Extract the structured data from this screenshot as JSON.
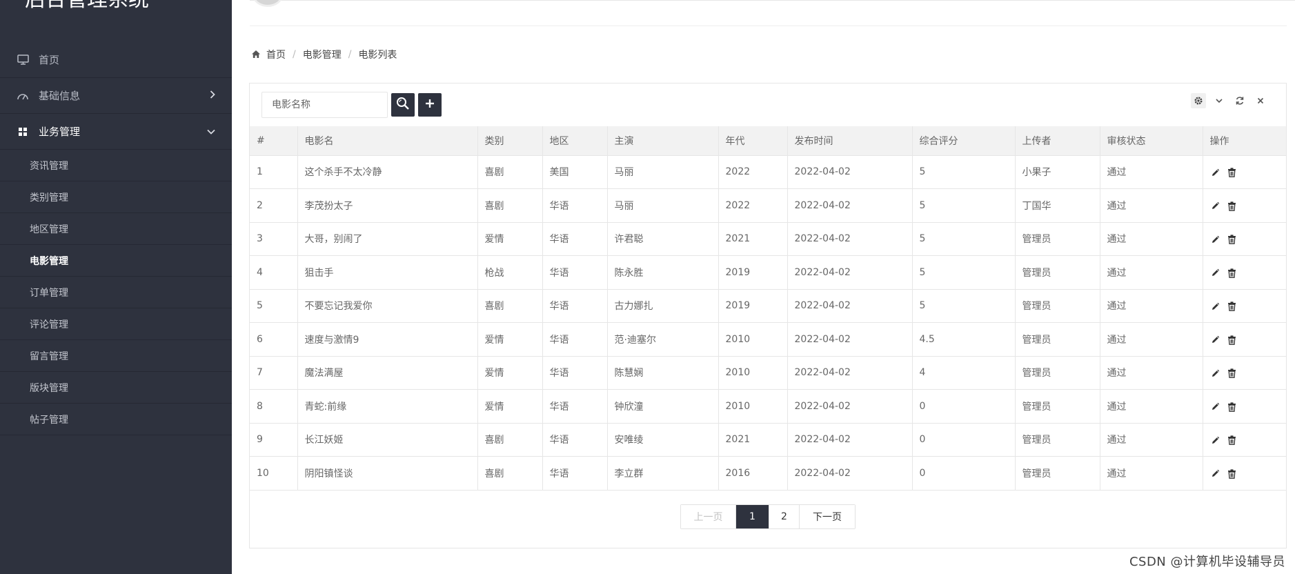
{
  "app": {
    "title": "后台管理系统"
  },
  "sidebar": {
    "items": [
      {
        "label": "首页",
        "icon": "monitor-icon"
      },
      {
        "label": "基础信息",
        "icon": "dashboard-gauge-icon"
      },
      {
        "label": "业务管理",
        "icon": "grid-apps-icon"
      }
    ],
    "submenu": [
      "资讯管理",
      "类别管理",
      "地区管理",
      "电影管理",
      "订单管理",
      "评论管理",
      "留言管理",
      "版块管理",
      "帖子管理"
    ],
    "active_sub": "电影管理"
  },
  "breadcrumb": {
    "home": "首页",
    "level2": "电影管理",
    "level3": "电影列表"
  },
  "search": {
    "placeholder": "电影名称"
  },
  "table": {
    "headers": [
      "#",
      "电影名",
      "类别",
      "地区",
      "主演",
      "年代",
      "发布时间",
      "综合评分",
      "上传者",
      "审核状态",
      "操作"
    ],
    "rows": [
      [
        "1",
        "这个杀手不太冷静",
        "喜剧",
        "美国",
        "马丽",
        "2022",
        "2022-04-02",
        "5",
        "小果子",
        "通过"
      ],
      [
        "2",
        "李茂扮太子",
        "喜剧",
        "华语",
        "马丽",
        "2022",
        "2022-04-02",
        "5",
        "丁国华",
        "通过"
      ],
      [
        "3",
        "大哥，别闹了",
        "爱情",
        "华语",
        "许君聪",
        "2021",
        "2022-04-02",
        "5",
        "管理员",
        "通过"
      ],
      [
        "4",
        "狙击手",
        "枪战",
        "华语",
        "陈永胜",
        "2019",
        "2022-04-02",
        "5",
        "管理员",
        "通过"
      ],
      [
        "5",
        "不要忘记我爱你",
        "喜剧",
        "华语",
        "古力娜扎",
        "2019",
        "2022-04-02",
        "5",
        "管理员",
        "通过"
      ],
      [
        "6",
        "速度与激情9",
        "爱情",
        "华语",
        "范·迪塞尔",
        "2010",
        "2022-04-02",
        "4.5",
        "管理员",
        "通过"
      ],
      [
        "7",
        "魔法满屋",
        "爱情",
        "华语",
        "陈慧娴",
        "2010",
        "2022-04-02",
        "4",
        "管理员",
        "通过"
      ],
      [
        "8",
        "青蛇:前缘",
        "爱情",
        "华语",
        "钟欣潼",
        "2010",
        "2022-04-02",
        "0",
        "管理员",
        "通过"
      ],
      [
        "9",
        "长江妖姬",
        "喜剧",
        "华语",
        "安唯绫",
        "2021",
        "2022-04-02",
        "0",
        "管理员",
        "通过"
      ],
      [
        "10",
        "阴阳镇怪谈",
        "喜剧",
        "华语",
        "李立群",
        "2016",
        "2022-04-02",
        "0",
        "管理员",
        "通过"
      ]
    ]
  },
  "pager": {
    "prev": "上一页",
    "pages": [
      "1",
      "2"
    ],
    "current": "1",
    "next": "下一页"
  },
  "watermark": "CSDN @计算机毕设辅导员",
  "colors": {
    "sidebar_bg": "#2e323e",
    "accent": "#2e323e"
  }
}
